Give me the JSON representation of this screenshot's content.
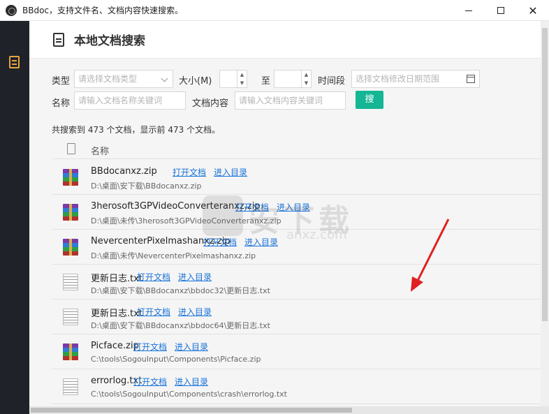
{
  "window": {
    "title": "BBdoc，支持文件名、文档内容快速搜索。",
    "minimize": "—",
    "maximize": "☐",
    "close": "✕"
  },
  "sidebar": {
    "icon": "document-list-icon"
  },
  "header": {
    "title": "本地文档搜索",
    "icon": "document-icon"
  },
  "filters": {
    "type_label": "类型",
    "type_placeholder": "请选择文档类型",
    "size_label": "大小(M)",
    "size_sep": "至",
    "size_min": "",
    "size_max": "",
    "time_label": "时间段",
    "time_placeholder": "选择文档修改日期范围",
    "name_label": "名称",
    "name_placeholder": "请输入文档名称关键词",
    "content_label": "文档内容",
    "content_placeholder": "请输入文档内容关键词",
    "search_button": "搜"
  },
  "summary": "共搜索到 473 个文档，显示前 473 个文档。",
  "table": {
    "name_header": "名称",
    "open_label": "打开文档",
    "dir_label": "进入目录",
    "rows": [
      {
        "name": "BBdocanxz.zip",
        "path": "D:\\桌面\\安下载\\BBdocanxz.zip",
        "type": "zip"
      },
      {
        "name": "3herosoft3GPVideoConverteranxz.zip",
        "path": "D:\\桌面\\未传\\3herosoft3GPVideoConverteranxz.zip",
        "type": "zip"
      },
      {
        "name": "NevercenterPixelmashanxz.zip",
        "path": "D:\\桌面\\未传\\NevercenterPixelmashanxz.zip",
        "type": "zip"
      },
      {
        "name": "更新日志.txt",
        "path": "D:\\桌面\\安下载\\BBdocanxz\\bbdoc32\\更新日志.txt",
        "type": "txt"
      },
      {
        "name": "更新日志.txt",
        "path": "D:\\桌面\\安下载\\BBdocanxz\\bbdoc64\\更新日志.txt",
        "type": "txt"
      },
      {
        "name": "Picface.zip",
        "path": "C:\\tools\\SogouInput\\Components\\Picface.zip",
        "type": "zip"
      },
      {
        "name": "errorlog.txt",
        "path": "C:\\tools\\SogouInput\\Components\\crash\\errorlog.txt",
        "type": "txt"
      }
    ]
  },
  "watermark": {
    "text": "安下载",
    "sub": "anxz.com"
  },
  "colors": {
    "accent": "#14b694",
    "link": "#1a73d9",
    "sidebar": "#1f2229",
    "arrow": "#e02020"
  }
}
